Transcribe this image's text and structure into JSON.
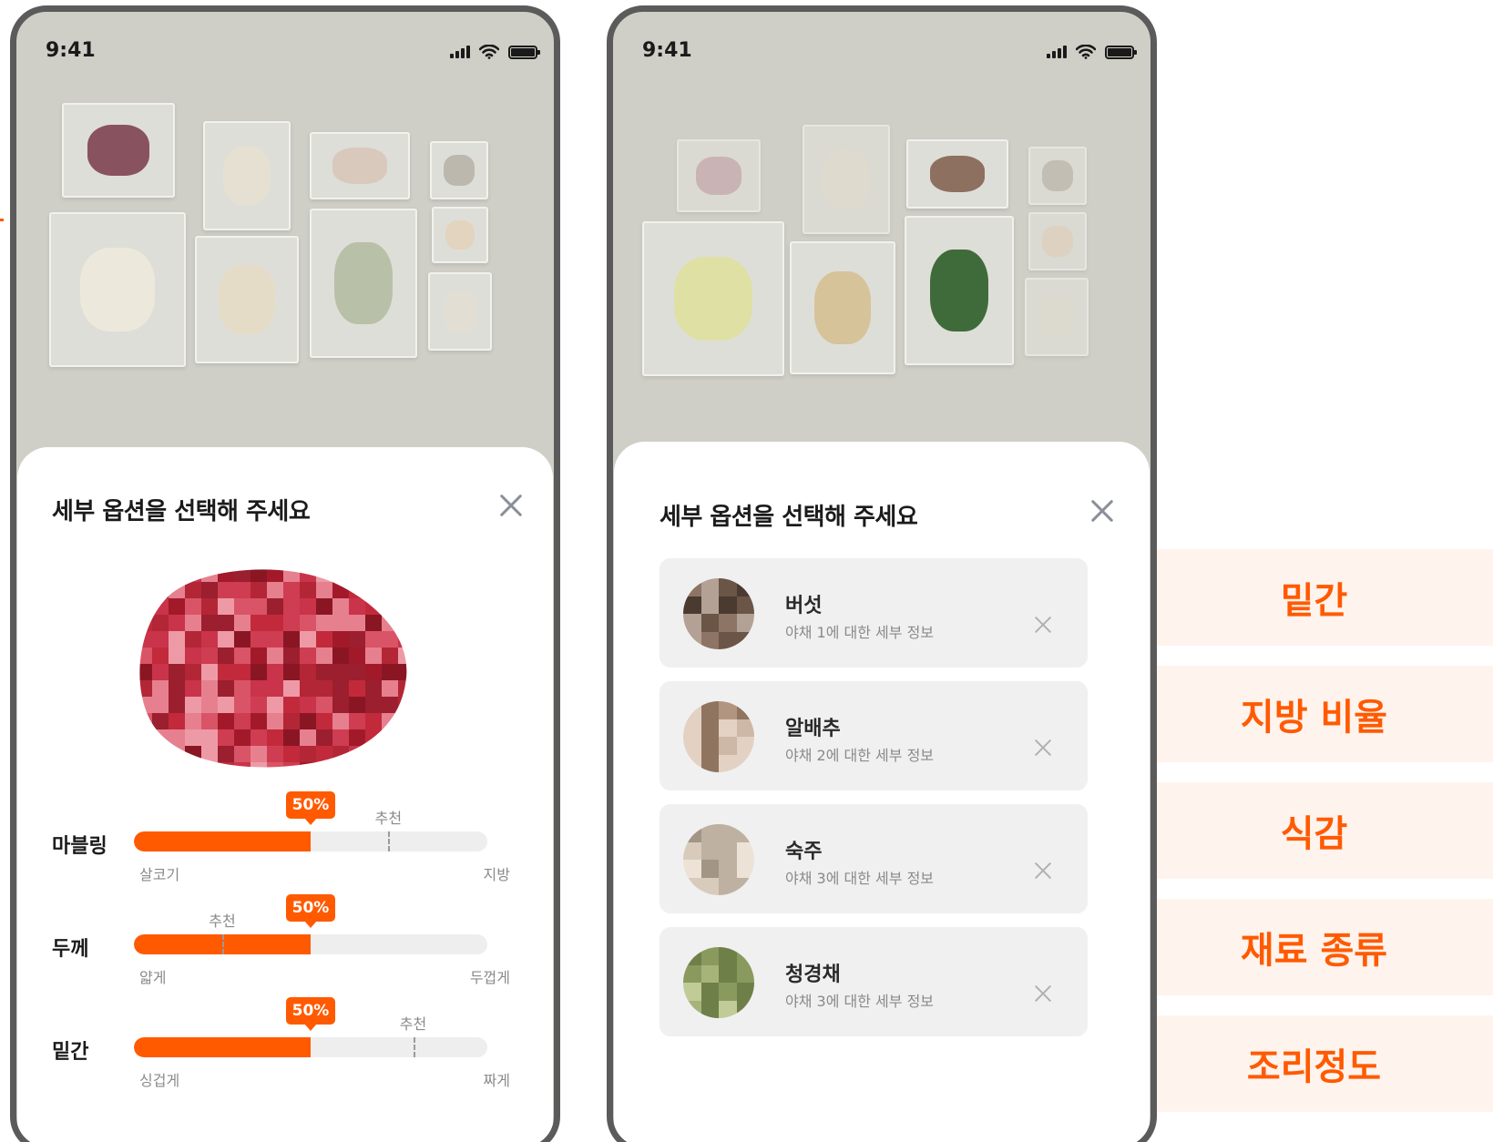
{
  "status_bar": {
    "time": "9:41"
  },
  "left_phone": {
    "sheet_title": "세부 옵션을 선택해 주세요",
    "sliders": [
      {
        "label": "마블링",
        "value_text": "50%",
        "value": 0.5,
        "recommend_text": "추천",
        "recommend": 0.72,
        "min_label": "살코기",
        "max_label": "지방"
      },
      {
        "label": "두께",
        "value_text": "50%",
        "value": 0.5,
        "recommend_text": "추천",
        "recommend": 0.25,
        "min_label": "얇게",
        "max_label": "두껍게"
      },
      {
        "label": "밑간",
        "value_text": "50%",
        "value": 0.5,
        "recommend_text": "추천",
        "recommend": 0.79,
        "min_label": "싱겁게",
        "max_label": "짜게"
      }
    ]
  },
  "right_phone": {
    "sheet_title": "세부 옵션을 선택해 주세요",
    "items": [
      {
        "name": "버섯",
        "desc": "야채 1에 대한 세부 정보",
        "palette": [
          "#4a3a30",
          "#6b5547",
          "#8d7464",
          "#b3a196"
        ]
      },
      {
        "name": "알배추",
        "desc": "야채 2에 대한 세부 정보",
        "palette": [
          "#8f7460",
          "#b29581",
          "#cdb7a6",
          "#e3d2c3"
        ]
      },
      {
        "name": "숙주",
        "desc": "야채 3에 대한 세부 정보",
        "palette": [
          "#a39585",
          "#bfb1a1",
          "#d8cbbb",
          "#ece3d6"
        ]
      },
      {
        "name": "청경채",
        "desc": "야채 3에 대한 세부 정보",
        "palette": [
          "#6e7f48",
          "#8a9a5e",
          "#a6b47a",
          "#c0cb98"
        ]
      }
    ]
  },
  "option_tags": [
    "밑간",
    "지방 비율",
    "식감",
    "재료 종류",
    "조리정도"
  ],
  "colors": {
    "accent": "#ff5a00",
    "tag_bg": "#fff3ee",
    "sheet_bg": "#ffffff",
    "photo_bg": "#cfcfc7"
  }
}
